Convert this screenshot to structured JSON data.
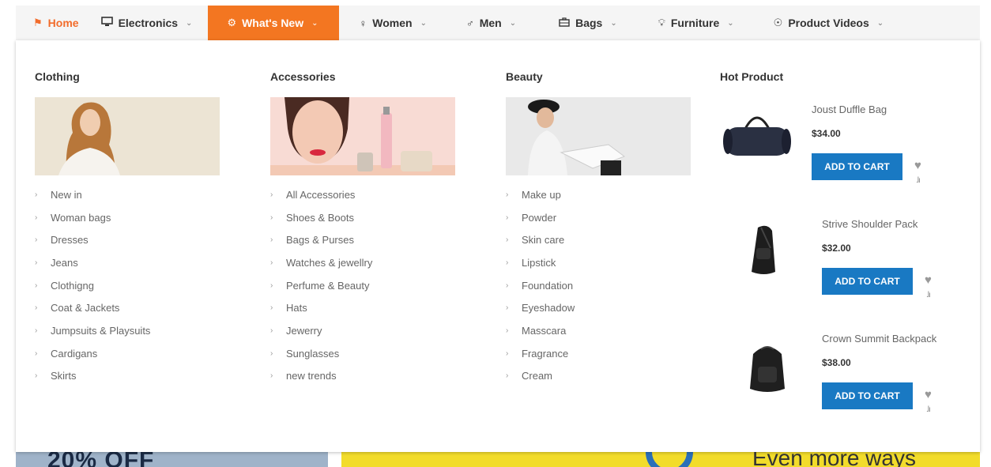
{
  "nav": {
    "items": [
      {
        "label": "Home",
        "icon": "home-icon"
      },
      {
        "label": "Electronics",
        "icon": "monitor-icon"
      },
      {
        "label": "What's New",
        "icon": "gear-icon"
      },
      {
        "label": "Women",
        "icon": "woman-icon"
      },
      {
        "label": "Men",
        "icon": "man-icon"
      },
      {
        "label": "Bags",
        "icon": "briefcase-icon"
      },
      {
        "label": "Furniture",
        "icon": "lamp-icon"
      },
      {
        "label": "Product Videos",
        "icon": "play-icon"
      }
    ]
  },
  "columns": [
    {
      "title": "Clothing",
      "items": [
        "New in",
        "Woman bags",
        "Dresses",
        "Jeans",
        "Clothigng",
        "Coat & Jackets",
        "Jumpsuits & Playsuits",
        "Cardigans",
        "Skirts"
      ]
    },
    {
      "title": "Accessories",
      "items": [
        "All Accessories",
        "Shoes & Boots",
        "Bags & Purses",
        "Watches & jewellry",
        "Perfume & Beauty",
        "Hats",
        "Jewerry",
        "Sunglasses",
        "new trends"
      ]
    },
    {
      "title": "Beauty",
      "items": [
        "Make up",
        "Powder",
        "Skin care",
        "Lipstick",
        "Foundation",
        "Eyeshadow",
        "Masscara",
        "Fragrance",
        "Cream"
      ]
    }
  ],
  "hot": {
    "title": "Hot Product",
    "cart_label": "ADD TO CART",
    "products": [
      {
        "name": "Joust Duffle Bag",
        "price": "$34.00"
      },
      {
        "name": "Strive Shoulder Pack",
        "price": "$32.00"
      },
      {
        "name": "Crown Summit Backpack",
        "price": "$38.00"
      }
    ]
  },
  "background": {
    "left_text": "20% OFF",
    "right_text": "Even more ways"
  },
  "colors": {
    "accent": "#f37621",
    "button": "#1979c3"
  }
}
